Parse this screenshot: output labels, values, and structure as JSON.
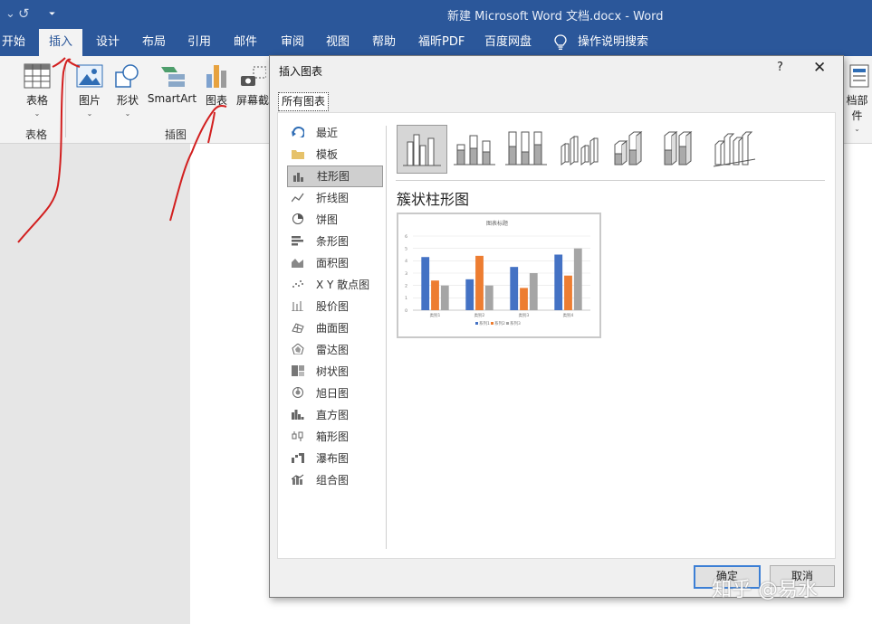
{
  "window": {
    "title": "新建 Microsoft Word 文档.docx  -  Word",
    "title_color": "#2b579a"
  },
  "quick_access": {
    "dropdown_glyph": "⌄",
    "redo_glyph": "↺",
    "customize_glyph": "⏷"
  },
  "tabs": [
    {
      "label": "开始",
      "active": false
    },
    {
      "label": "插入",
      "active": true
    },
    {
      "label": "设计",
      "active": false
    },
    {
      "label": "布局",
      "active": false
    },
    {
      "label": "引用",
      "active": false
    },
    {
      "label": "邮件",
      "active": false
    },
    {
      "label": "审阅",
      "active": false
    },
    {
      "label": "视图",
      "active": false
    },
    {
      "label": "帮助",
      "active": false
    },
    {
      "label": "福昕PDF",
      "active": false
    },
    {
      "label": "百度网盘",
      "active": false
    },
    {
      "label": "操作说明搜索",
      "active": false,
      "icon": "lightbulb-icon"
    }
  ],
  "ribbon": {
    "buttons": [
      {
        "label": "表格",
        "icon": "table-icon"
      },
      {
        "label": "图片",
        "icon": "picture-icon"
      },
      {
        "label": "形状",
        "icon": "shapes-icon"
      },
      {
        "label": "SmartArt",
        "icon": "smartart-icon"
      },
      {
        "label": "图表",
        "icon": "chart-icon"
      },
      {
        "label": "屏幕截",
        "icon": "screenshot-icon"
      },
      {
        "label": "档部件",
        "icon": "doc-parts-icon"
      }
    ],
    "groups": [
      {
        "label": "表格"
      },
      {
        "label": "插图"
      }
    ]
  },
  "dialog": {
    "title": "插入图表",
    "help_glyph": "?",
    "close_glyph": "✕",
    "tab_label": "所有图表",
    "categories": [
      {
        "label": "最近",
        "icon": "recent-icon"
      },
      {
        "label": "模板",
        "icon": "folder-icon"
      },
      {
        "label": "柱形图",
        "icon": "column-chart-icon",
        "selected": true
      },
      {
        "label": "折线图",
        "icon": "line-chart-icon"
      },
      {
        "label": "饼图",
        "icon": "pie-chart-icon"
      },
      {
        "label": "条形图",
        "icon": "bar-chart-icon"
      },
      {
        "label": "面积图",
        "icon": "area-chart-icon"
      },
      {
        "label": "X Y 散点图",
        "icon": "scatter-chart-icon"
      },
      {
        "label": "股价图",
        "icon": "stock-chart-icon"
      },
      {
        "label": "曲面图",
        "icon": "surface-chart-icon"
      },
      {
        "label": "雷达图",
        "icon": "radar-chart-icon"
      },
      {
        "label": "树状图",
        "icon": "treemap-chart-icon"
      },
      {
        "label": "旭日图",
        "icon": "sunburst-chart-icon"
      },
      {
        "label": "直方图",
        "icon": "histogram-chart-icon"
      },
      {
        "label": "箱形图",
        "icon": "box-whisker-chart-icon"
      },
      {
        "label": "瀑布图",
        "icon": "waterfall-chart-icon"
      },
      {
        "label": "组合图",
        "icon": "combo-chart-icon"
      }
    ],
    "subtypes": [
      {
        "icon": "clustered-column-icon",
        "selected": true
      },
      {
        "icon": "stacked-column-icon"
      },
      {
        "icon": "100-stacked-column-icon"
      },
      {
        "icon": "3d-clustered-column-icon"
      },
      {
        "icon": "3d-stacked-column-icon"
      },
      {
        "icon": "3d-100-stacked-column-icon"
      },
      {
        "icon": "3d-column-icon"
      }
    ],
    "selected_type_name": "簇状柱形图",
    "ok_label": "确定",
    "cancel_label": "取消"
  },
  "chart_data": {
    "type": "bar",
    "title": "图表标题",
    "categories": [
      "类别1",
      "类别2",
      "类别3",
      "类别4"
    ],
    "series": [
      {
        "name": "系列1",
        "values": [
          4.3,
          2.5,
          3.5,
          4.5
        ],
        "color": "#4472c4"
      },
      {
        "name": "系列2",
        "values": [
          2.4,
          4.4,
          1.8,
          2.8
        ],
        "color": "#ed7d31"
      },
      {
        "name": "系列3",
        "values": [
          2,
          2,
          3,
          5
        ],
        "color": "#a5a5a5"
      }
    ],
    "ylim": [
      0,
      6
    ],
    "yticks": [
      "0",
      "1",
      "2",
      "3",
      "4",
      "5",
      "6"
    ],
    "grid": true,
    "legend": "bottom"
  },
  "watermark": "知乎 @易水"
}
